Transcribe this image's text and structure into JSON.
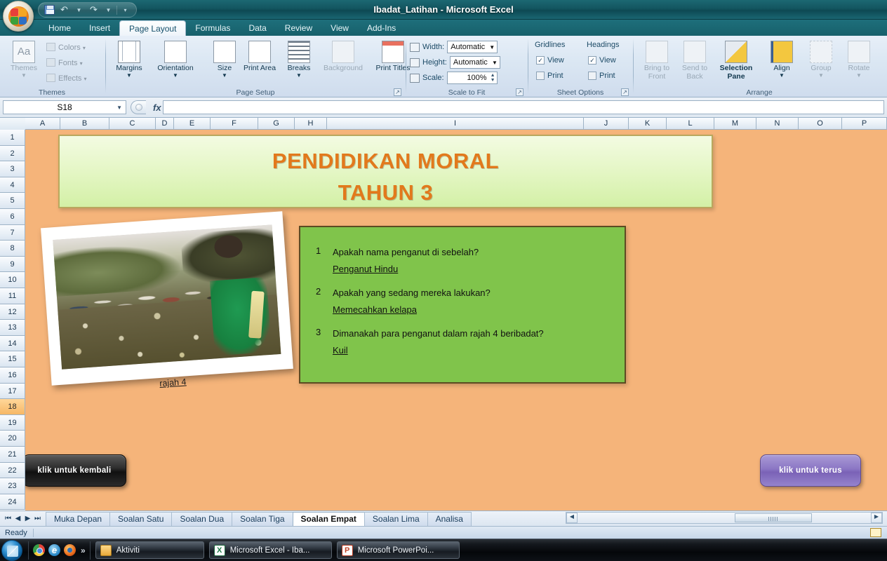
{
  "window": {
    "title": "Ibadat_Latihan - Microsoft Excel",
    "office_button": "office-button",
    "quick_access": [
      {
        "name": "save",
        "label": "Save"
      },
      {
        "name": "undo",
        "label": "Undo"
      },
      {
        "name": "redo",
        "label": "Redo"
      },
      {
        "name": "customize",
        "label": "Customize Quick Access Toolbar"
      }
    ]
  },
  "ribbon": {
    "tabs": [
      {
        "label": "Home",
        "active": false
      },
      {
        "label": "Insert",
        "active": false
      },
      {
        "label": "Page Layout",
        "active": true
      },
      {
        "label": "Formulas",
        "active": false
      },
      {
        "label": "Data",
        "active": false
      },
      {
        "label": "Review",
        "active": false
      },
      {
        "label": "View",
        "active": false
      },
      {
        "label": "Add-Ins",
        "active": false
      }
    ],
    "groups": {
      "themes": {
        "label": "Themes",
        "themes_button": "Themes",
        "colors": "Colors",
        "fonts": "Fonts",
        "effects": "Effects"
      },
      "page_setup": {
        "label": "Page Setup",
        "items": [
          {
            "label": "Margins",
            "caret": true,
            "disabled": false
          },
          {
            "label": "Orientation",
            "caret": true,
            "disabled": false
          },
          {
            "label": "Size",
            "caret": true,
            "disabled": false
          },
          {
            "label": "Print Area",
            "caret": true,
            "disabled": false
          },
          {
            "label": "Breaks",
            "caret": true,
            "disabled": false
          },
          {
            "label": "Background",
            "caret": false,
            "disabled": true
          },
          {
            "label": "Print Titles",
            "caret": false,
            "disabled": false
          }
        ]
      },
      "scale_to_fit": {
        "label": "Scale to Fit",
        "width_label": "Width:",
        "width_value": "Automatic",
        "height_label": "Height:",
        "height_value": "Automatic",
        "scale_label": "Scale:",
        "scale_value": "100%"
      },
      "sheet_options": {
        "label": "Sheet Options",
        "gridlines_label": "Gridlines",
        "headings_label": "Headings",
        "view_label": "View",
        "print_label": "Print",
        "gridlines_view_checked": true,
        "gridlines_print_checked": false,
        "headings_view_checked": true,
        "headings_print_checked": false
      },
      "arrange": {
        "label": "Arrange",
        "items": [
          {
            "label": "Bring to Front",
            "caret": true,
            "disabled": true
          },
          {
            "label": "Send to Back",
            "caret": true,
            "disabled": true
          },
          {
            "label": "Selection Pane",
            "caret": false,
            "disabled": false
          },
          {
            "label": "Align",
            "caret": true,
            "disabled": false
          },
          {
            "label": "Group",
            "caret": true,
            "disabled": true
          },
          {
            "label": "Rotate",
            "caret": true,
            "disabled": true
          }
        ]
      }
    }
  },
  "formula_bar": {
    "name_box_value": "S18",
    "formula_value": "",
    "fx_label": "fx"
  },
  "grid": {
    "columns": [
      "A",
      "B",
      "C",
      "D",
      "E",
      "F",
      "G",
      "H",
      "I",
      "J",
      "K",
      "L",
      "M",
      "N",
      "O",
      "P"
    ],
    "rows": [
      "1",
      "2",
      "3",
      "4",
      "5",
      "6",
      "7",
      "8",
      "9",
      "10",
      "11",
      "12",
      "13",
      "14",
      "15",
      "16",
      "17",
      "18",
      "19",
      "20",
      "21",
      "22",
      "23",
      "24"
    ],
    "selected_row": "18",
    "background_color": "#f5b47a"
  },
  "slide": {
    "title_line_1": "PENDIDIKAN MORAL",
    "title_line_2": "TAHUN 3",
    "title_text_color": "#e2791c",
    "title_box_border_color": "#b9a85e",
    "photo_caption": "rajah 4",
    "question_box_color": "#80c44b",
    "questions": [
      {
        "number": "1",
        "question": "Apakah nama penganut di sebelah?",
        "answer": "Penganut Hindu"
      },
      {
        "number": "2",
        "question": "Apakah yang sedang mereka lakukan?",
        "answer": "Memecahkan kelapa"
      },
      {
        "number": "3",
        "question": "Dimanakah para penganut dalam rajah 4 beribadat?",
        "answer": "Kuil"
      }
    ],
    "back_button": "klik untuk kembali",
    "next_button": "klik untuk terus"
  },
  "sheet_tabs": {
    "items": [
      {
        "label": "Muka Depan",
        "active": false
      },
      {
        "label": "Soalan Satu",
        "active": false
      },
      {
        "label": "Soalan Dua",
        "active": false
      },
      {
        "label": "Soalan Tiga",
        "active": false
      },
      {
        "label": "Soalan Empat",
        "active": true
      },
      {
        "label": "Soalan Lima",
        "active": false
      },
      {
        "label": "Analisa",
        "active": false
      }
    ]
  },
  "status_bar": {
    "status": "Ready"
  },
  "taskbar": {
    "start": "start-button",
    "quick_launch": [
      "chrome-icon",
      "internet-explorer-icon",
      "firefox-icon"
    ],
    "show_more": "»",
    "buttons": [
      {
        "label": "Aktiviti",
        "icon": "folder-icon"
      },
      {
        "label": "Microsoft Excel - Iba...",
        "icon": "excel-icon"
      },
      {
        "label": "Microsoft PowerPoi...",
        "icon": "powerpoint-icon"
      }
    ]
  }
}
